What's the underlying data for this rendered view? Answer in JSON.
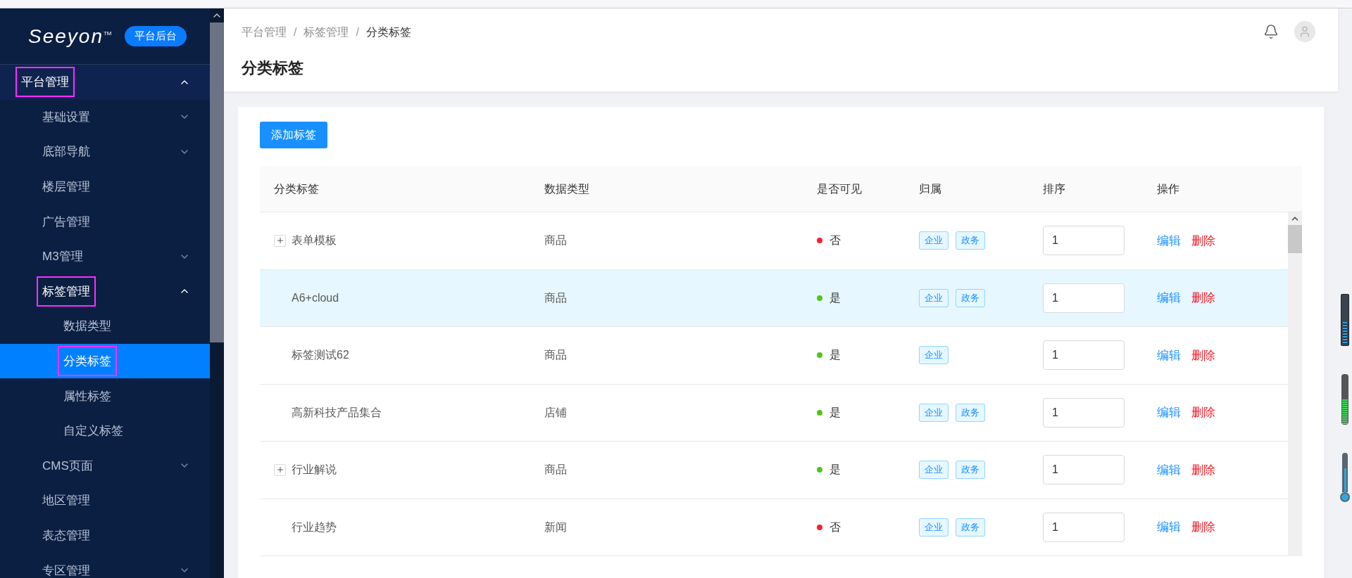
{
  "sidebar": {
    "logo": "Seeyon",
    "logo_mark": "TM",
    "badge": "平台后台",
    "items": [
      {
        "label": "平台管理",
        "expandable": true,
        "expanded": true,
        "selected": false,
        "highlighted": true,
        "children": [
          {
            "label": "基础设置",
            "expandable": true,
            "expanded": false,
            "selected": false,
            "highlighted": false
          },
          {
            "label": "底部导航",
            "expandable": true,
            "expanded": false,
            "selected": false,
            "highlighted": false
          },
          {
            "label": "楼层管理",
            "expandable": false,
            "expanded": false,
            "selected": false,
            "highlighted": false
          },
          {
            "label": "广告管理",
            "expandable": false,
            "expanded": false,
            "selected": false,
            "highlighted": false
          },
          {
            "label": "M3管理",
            "expandable": true,
            "expanded": false,
            "selected": false,
            "highlighted": false
          },
          {
            "label": "标签管理",
            "expandable": true,
            "expanded": true,
            "selected": false,
            "highlighted": true,
            "children": [
              {
                "label": "数据类型",
                "expandable": false,
                "expanded": false,
                "selected": false,
                "highlighted": false
              },
              {
                "label": "分类标签",
                "expandable": false,
                "expanded": false,
                "selected": true,
                "highlighted": true
              },
              {
                "label": "属性标签",
                "expandable": false,
                "expanded": false,
                "selected": false,
                "highlighted": false
              },
              {
                "label": "自定义标签",
                "expandable": false,
                "expanded": false,
                "selected": false,
                "highlighted": false
              }
            ]
          },
          {
            "label": "CMS页面",
            "expandable": true,
            "expanded": false,
            "selected": false,
            "highlighted": false
          },
          {
            "label": "地区管理",
            "expandable": false,
            "expanded": false,
            "selected": false,
            "highlighted": false
          },
          {
            "label": "表态管理",
            "expandable": false,
            "expanded": false,
            "selected": false,
            "highlighted": false
          },
          {
            "label": "专区管理",
            "expandable": true,
            "expanded": false,
            "selected": false,
            "highlighted": false
          }
        ]
      }
    ]
  },
  "header": {
    "breadcrumb": [
      "平台管理",
      "标签管理",
      "分类标签"
    ],
    "separator": "/",
    "title": "分类标签"
  },
  "add_button": "添加标签",
  "table": {
    "columns": [
      "分类标签",
      "数据类型",
      "是否可见",
      "归属",
      "排序",
      "操作"
    ],
    "rows": [
      {
        "name": "表单模板",
        "expandable": true,
        "type": "商品",
        "visible": false,
        "visible_text": "否",
        "tags": [
          "企业",
          "政务"
        ],
        "order": "1",
        "actions": [
          "编辑",
          "删除"
        ],
        "selected": false
      },
      {
        "name": "A6+cloud",
        "expandable": false,
        "type": "商品",
        "visible": true,
        "visible_text": "是",
        "tags": [
          "企业",
          "政务"
        ],
        "order": "1",
        "actions": [
          "编辑",
          "删除"
        ],
        "selected": true
      },
      {
        "name": "标签测试62",
        "expandable": false,
        "type": "商品",
        "visible": true,
        "visible_text": "是",
        "tags": [
          "企业"
        ],
        "order": "1",
        "actions": [
          "编辑",
          "删除"
        ],
        "selected": false
      },
      {
        "name": "高新科技产品集合",
        "expandable": false,
        "type": "店铺",
        "visible": true,
        "visible_text": "是",
        "tags": [
          "企业",
          "政务"
        ],
        "order": "1",
        "actions": [
          "编辑",
          "删除"
        ],
        "selected": false
      },
      {
        "name": "行业解说",
        "expandable": true,
        "type": "商品",
        "visible": true,
        "visible_text": "是",
        "tags": [
          "企业",
          "政务"
        ],
        "order": "1",
        "actions": [
          "编辑",
          "删除"
        ],
        "selected": false
      },
      {
        "name": "行业趋势",
        "expandable": false,
        "type": "新闻",
        "visible": false,
        "visible_text": "否",
        "tags": [
          "企业",
          "政务"
        ],
        "order": "1",
        "actions": [
          "编辑",
          "删除"
        ],
        "selected": false
      }
    ]
  },
  "gadgets": [
    {
      "kind": "meter",
      "level": 0.45
    },
    {
      "kind": "bar",
      "level": 0.5
    },
    {
      "kind": "thermometer",
      "level": 0.6
    }
  ]
}
